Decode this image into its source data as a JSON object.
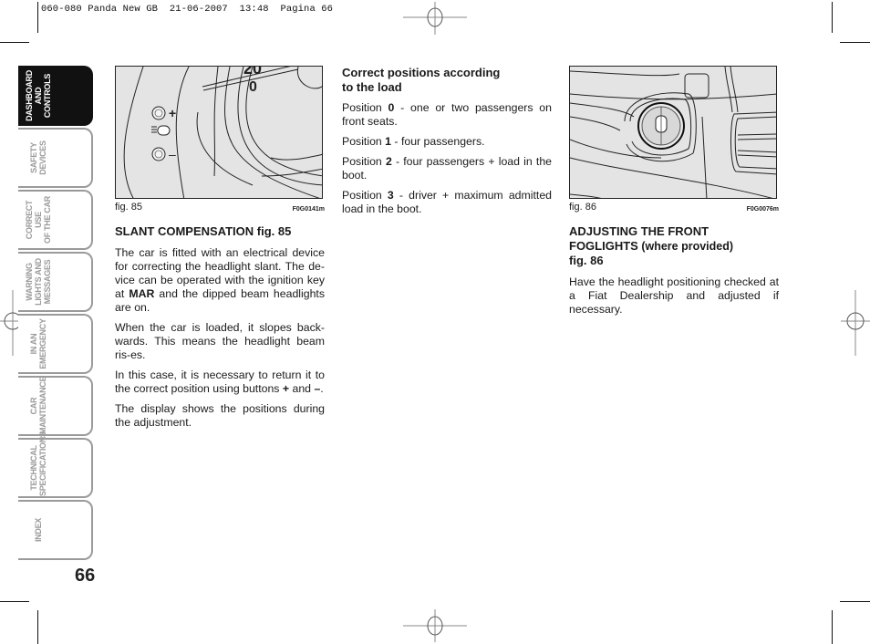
{
  "slug_line": "060-080 Panda New GB  21-06-2007  13:48  Pagina 66",
  "page_number": "66",
  "side_tabs": [
    {
      "lines": [
        "Dashboard",
        "and controls"
      ],
      "active": true
    },
    {
      "lines": [
        "Safety",
        "devices"
      ],
      "active": false
    },
    {
      "lines": [
        "Correct use",
        "of the car"
      ],
      "active": false
    },
    {
      "lines": [
        "Warning",
        "lights and",
        "messages"
      ],
      "active": false
    },
    {
      "lines": [
        "In an",
        "emergency"
      ],
      "active": false
    },
    {
      "lines": [
        "Car",
        "maintenance"
      ],
      "active": false
    },
    {
      "lines": [
        "Technical",
        "specifications"
      ],
      "active": false
    },
    {
      "lines": [
        "Index"
      ],
      "active": false
    }
  ],
  "col1": {
    "figure": {
      "label": "fig. 85",
      "code": "F0G0141m",
      "dial_digits": [
        "20",
        "0"
      ],
      "buttons": [
        "+",
        "–"
      ]
    },
    "heading": "SLANT COMPENSATION fig. 85",
    "p1_a": "The car is fitted with an electrical device for correcting the headlight slant. The de-vice can be operated with the ignition key at ",
    "p1_bold": "MAR",
    "p1_b": " and the dipped beam headlights are on.",
    "p2": "When the car is loaded, it slopes back-wards. This means the headlight beam ris-es.",
    "p3_a": "In this case, it is necessary to return it to the correct position using buttons ",
    "p3_plus": "+",
    "p3_and": " and ",
    "p3_minus": "–",
    "p3_end": ".",
    "p4": "The display shows the positions during the adjustment."
  },
  "col2": {
    "heading_l1": "Correct positions according",
    "heading_l2": "to the load",
    "positions": [
      {
        "prefix": "Position ",
        "num": "0",
        "text": " - one or two passengers on front seats."
      },
      {
        "prefix": "Position ",
        "num": "1",
        "text": " - four passengers."
      },
      {
        "prefix": "Position ",
        "num": "2",
        "text": " - four passengers + load in the boot."
      },
      {
        "prefix": "Position ",
        "num": "3",
        "text": " - driver + maximum admitted load in the boot."
      }
    ]
  },
  "col3": {
    "figure": {
      "label": "fig. 86",
      "code": "F0G0076m"
    },
    "heading_l1": "ADJUSTING THE FRONT",
    "heading_l2a": "FOGLIGHTS",
    "heading_l2b": " (where provided)",
    "heading_l3": "fig. 86",
    "p1": "Have the headlight positioning checked at a Fiat Dealership and adjusted if necessary."
  }
}
